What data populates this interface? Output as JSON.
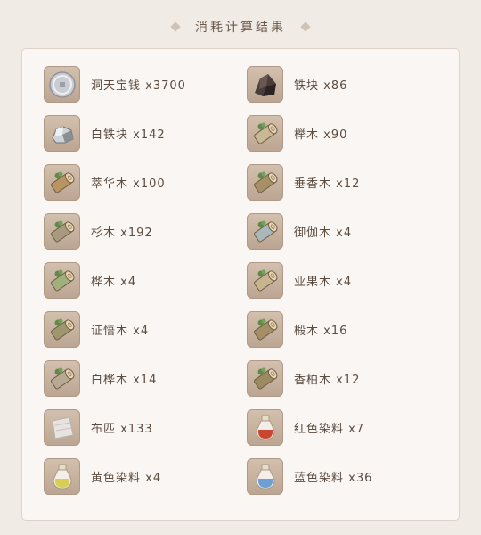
{
  "header": {
    "title": "消耗计算结果"
  },
  "materials_left": [
    {
      "name": "洞天宝钱",
      "qty": "x3700",
      "icon": "coin-icon",
      "color": "#c9ccd2",
      "label": "洞天宝钱 x3700"
    },
    {
      "name": "白铁块",
      "qty": "x142",
      "icon": "white-iron-chunk-icon",
      "color": "#cfd2d6",
      "label": "白铁块 x142"
    },
    {
      "name": "萃华木",
      "qty": "x100",
      "icon": "log-icon",
      "color": "#b89463",
      "label": "萃华木 x100"
    },
    {
      "name": "杉木",
      "qty": "x192",
      "icon": "log-icon",
      "color": "#a89a7e",
      "label": "杉木 x192"
    },
    {
      "name": "桦木",
      "qty": "x4",
      "icon": "log-icon",
      "color": "#9fb07a",
      "label": "桦木 x4"
    },
    {
      "name": "证悟木",
      "qty": "x4",
      "icon": "log-icon",
      "color": "#a0966e",
      "label": "证悟木 x4"
    },
    {
      "name": "白桦木",
      "qty": "x14",
      "icon": "log-icon",
      "color": "#b6ab92",
      "label": "白桦木 x14"
    },
    {
      "name": "布匹",
      "qty": "x133",
      "icon": "cloth-icon",
      "color": "#e6e3e0",
      "label": "布匹 x133"
    },
    {
      "name": "黄色染料",
      "qty": "x4",
      "icon": "yellow-dye-bottle-icon",
      "color": "#d8cf52",
      "label": "黄色染料 x4"
    }
  ],
  "materials_right": [
    {
      "name": "铁块",
      "qty": "x86",
      "icon": "iron-chunk-icon",
      "color": "#4a3d3a",
      "label": "铁块 x86"
    },
    {
      "name": "榉木",
      "qty": "x90",
      "icon": "log-icon",
      "color": "#c7b896",
      "label": "榉木 x90"
    },
    {
      "name": "垂香木",
      "qty": "x12",
      "icon": "log-icon",
      "color": "#a79066",
      "label": "垂香木 x12"
    },
    {
      "name": "御伽木",
      "qty": "x4",
      "icon": "log-icon",
      "color": "#aab7bb",
      "label": "御伽木 x4"
    },
    {
      "name": "业果木",
      "qty": "x4",
      "icon": "log-icon",
      "color": "#c9b490",
      "label": "业果木 x4"
    },
    {
      "name": "椴木",
      "qty": "x16",
      "icon": "log-icon",
      "color": "#a48e66",
      "label": "椴木 x16"
    },
    {
      "name": "香柏木",
      "qty": "x12",
      "icon": "log-icon",
      "color": "#9b8a62",
      "label": "香柏木 x12"
    },
    {
      "name": "红色染料",
      "qty": "x7",
      "icon": "red-dye-bottle-icon",
      "color": "#c84632",
      "label": "红色染料 x7"
    },
    {
      "name": "蓝色染料",
      "qty": "x36",
      "icon": "blue-dye-bottle-icon",
      "color": "#6c9fd4",
      "label": "蓝色染料 x36"
    }
  ]
}
